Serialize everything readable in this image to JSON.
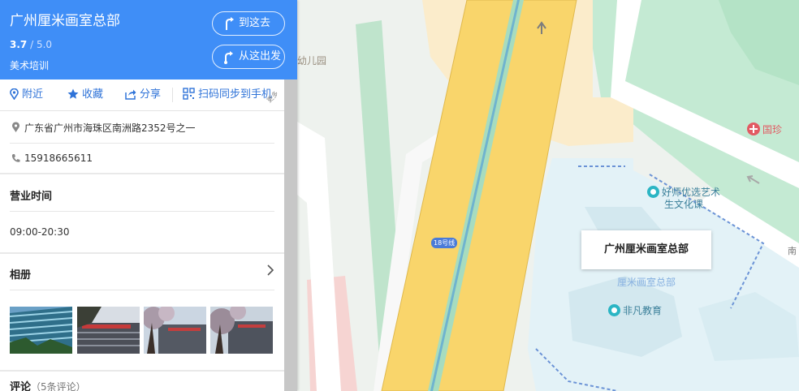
{
  "place": {
    "title": "广州厘米画室总部",
    "rating_score": "3.7",
    "rating_sep": "/",
    "rating_max": "5.0",
    "category": "美术培训"
  },
  "header_buttons": {
    "go_here": "到这去",
    "from_here": "从这出发"
  },
  "actions": {
    "nearby": "附近",
    "favorite": "收藏",
    "share": "分享",
    "scan_sync": "扫码同步到手机",
    "more": "更多"
  },
  "details": {
    "address": "广东省广州市海珠区南洲路2352号之一",
    "phone": "15918665611"
  },
  "sections": {
    "hours_title": "营业时间",
    "hours_value": "09:00-20:30",
    "album_title": "相册",
    "reviews_title": "评论",
    "reviews_count": "（5条评论）"
  },
  "map": {
    "callout_title": "广州厘米画室总部",
    "marker_label": "厘米画室总部",
    "metro_line": "18号线",
    "poi_art_1": "好师优选艺术",
    "poi_art_2": "生文化课",
    "poi_feifan": "非凡教育",
    "poi_guozhen": "国珍",
    "poi_kindergarten": "幼儿园",
    "road_partial": "南"
  },
  "colors": {
    "header_blue": "#3f8ef7",
    "action_blue": "#2f73d8",
    "road_yellow": "#f9d56b",
    "park_green": "#bfe8cf",
    "marker_red": "#e8413c"
  }
}
